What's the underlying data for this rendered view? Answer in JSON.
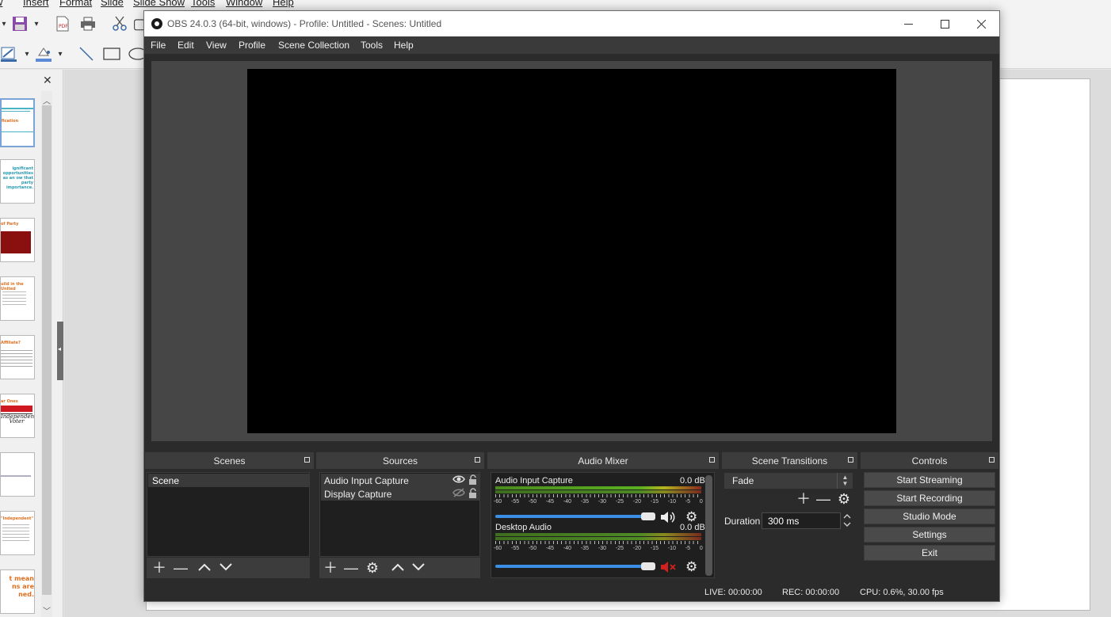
{
  "background_app": {
    "menu": [
      "w",
      "Insert",
      "Format",
      "Slide",
      "Slide Show",
      "Tools",
      "Window",
      "Help"
    ],
    "slides": [
      {
        "text": "fication"
      },
      {
        "text": "ignificant opportunities as an ow that party importance."
      },
      {
        "text": "of Party"
      },
      {
        "text": "uild in the United"
      },
      {
        "text": "Affiliate?"
      },
      {
        "text": "ar Ones"
      },
      {
        "text": ""
      },
      {
        "text": "\"Independent\""
      },
      {
        "text": "t mean ns are ned."
      }
    ]
  },
  "obs": {
    "title": "OBS 24.0.3 (64-bit, windows) - Profile: Untitled - Scenes: Untitled",
    "menu": [
      "File",
      "Edit",
      "View",
      "Profile",
      "Scene Collection",
      "Tools",
      "Help"
    ],
    "docks": {
      "scenes": "Scenes",
      "sources": "Sources",
      "mixer": "Audio Mixer",
      "transitions": "Scene Transitions",
      "controls": "Controls"
    },
    "scenes": [
      "Scene"
    ],
    "sources": [
      {
        "name": "Audio Input Capture",
        "visible": true
      },
      {
        "name": "Display Capture",
        "visible": false
      }
    ],
    "mixer": {
      "tick_labels": [
        "-60",
        "-55",
        "-50",
        "-45",
        "-40",
        "-35",
        "-30",
        "-25",
        "-20",
        "-15",
        "-10",
        "-5",
        "0"
      ],
      "channels": [
        {
          "name": "Audio Input Capture",
          "db": "0.0 dB",
          "muted": false
        },
        {
          "name": "Desktop Audio",
          "db": "0.0 dB",
          "muted": true
        }
      ]
    },
    "transitions": {
      "selected": "Fade",
      "duration_label": "Duration",
      "duration_value": "300 ms"
    },
    "controls": [
      "Start Streaming",
      "Start Recording",
      "Studio Mode",
      "Settings",
      "Exit"
    ],
    "status": {
      "live": "LIVE: 00:00:00",
      "rec": "REC: 00:00:00",
      "cpu": "CPU: 0.6%, 30.00 fps"
    }
  }
}
